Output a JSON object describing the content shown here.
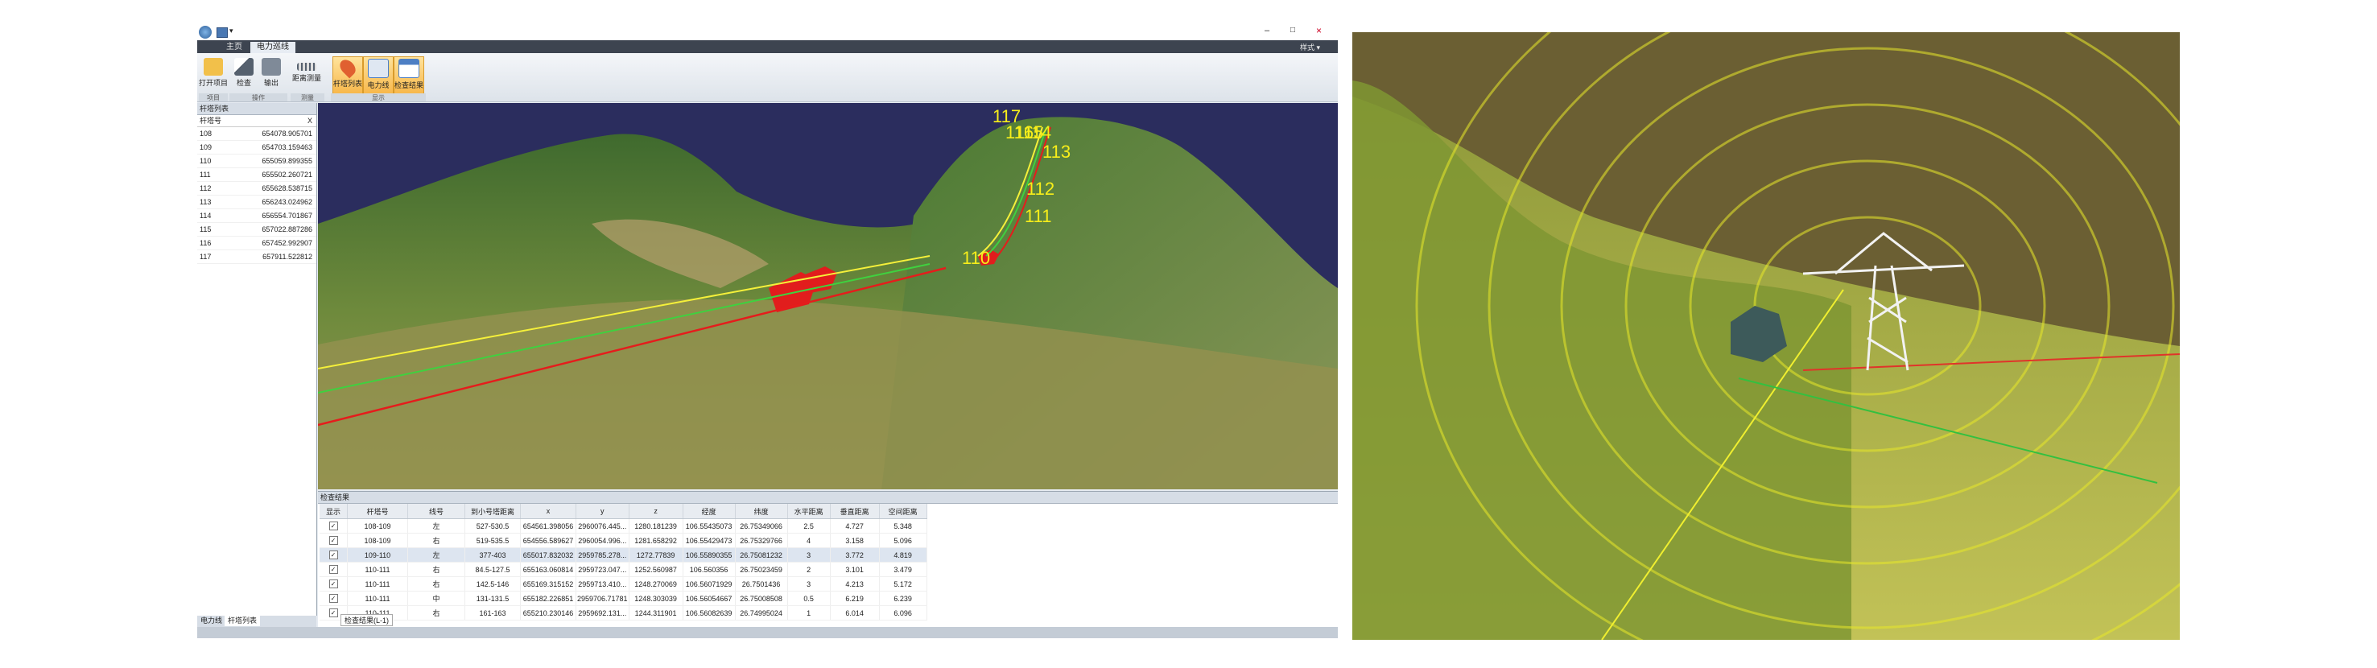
{
  "titlebar": {
    "window_controls": [
      "–",
      "□",
      "×"
    ],
    "quick_access": "▾",
    "style_menu": "样式 ▾"
  },
  "ribbon": {
    "tabs": [
      "主页",
      "电力巡线"
    ],
    "active_tab": 1,
    "buttons": [
      {
        "label": "打开项目",
        "icon": "folder-icon",
        "color": "#f2c04a"
      },
      {
        "label": "检查",
        "icon": "measure-icon",
        "color": "#55606e"
      },
      {
        "label": "输出",
        "icon": "export-icon",
        "color": "#55606e"
      },
      {
        "label": "距离测量",
        "icon": "ruler-icon",
        "color": "#55606e"
      },
      {
        "label": "杆塔列表",
        "icon": "location-pin-icon",
        "color": "#e06030"
      },
      {
        "label": "电力线",
        "icon": "powerline-icon",
        "color": "#4d7fc4"
      },
      {
        "label": "检查结果",
        "icon": "results-icon",
        "color": "#4d7fc4"
      }
    ],
    "groups": [
      "项目",
      "操作",
      "测量",
      "显示"
    ]
  },
  "tower_panel": {
    "title": "杆塔列表",
    "columns": [
      "杆塔号",
      "X"
    ],
    "rows": [
      [
        "108",
        "654078.905701"
      ],
      [
        "109",
        "654703.159463"
      ],
      [
        "110",
        "655059.899355"
      ],
      [
        "111",
        "655502.260721"
      ],
      [
        "112",
        "655628.538715"
      ],
      [
        "113",
        "656243.024962"
      ],
      [
        "114",
        "656554.701867"
      ],
      [
        "115",
        "657022.887286"
      ],
      [
        "116",
        "657452.992907"
      ],
      [
        "117",
        "657911.522812"
      ]
    ],
    "bottom_tabs": [
      "电力线",
      "杆塔列表"
    ]
  },
  "viewport": {
    "tower_labels": [
      "117",
      "116",
      "115",
      "114",
      "113",
      "112",
      "111",
      "110"
    ],
    "colors": {
      "sky": "#2b2d5e",
      "yellow_line": "#f5f03a",
      "green_line": "#3fd13f",
      "red_line": "#e51c1c",
      "label": "#f7ee1a"
    }
  },
  "results_panel": {
    "title": "检查结果",
    "columns": [
      "显示",
      "杆塔号",
      "线号",
      "到小号塔距离",
      "x",
      "y",
      "z",
      "经度",
      "纬度",
      "水平距离",
      "垂直距离",
      "空间距离"
    ],
    "rows": [
      [
        "✓",
        "108-109",
        "左",
        "527-530.5",
        "654561.398056",
        "2960076.445...",
        "1280.181239",
        "106.55435073",
        "26.75349066",
        "2.5",
        "4.727",
        "5.348"
      ],
      [
        "✓",
        "108-109",
        "右",
        "519-535.5",
        "654556.589627",
        "2960054.996...",
        "1281.658292",
        "106.55429473",
        "26.75329766",
        "4",
        "3.158",
        "5.096"
      ],
      [
        "✓",
        "109-110",
        "左",
        "377-403",
        "655017.832032",
        "2959785.278...",
        "1272.77839",
        "106.55890355",
        "26.75081232",
        "3",
        "3.772",
        "4.819"
      ],
      [
        "✓",
        "110-111",
        "右",
        "84.5-127.5",
        "655163.060814",
        "2959723.047...",
        "1252.560987",
        "106.560356",
        "26.75023459",
        "2",
        "3.101",
        "3.479"
      ],
      [
        "✓",
        "110-111",
        "右",
        "142.5-146",
        "655169.315152",
        "2959713.410...",
        "1248.270069",
        "106.56071929",
        "26.7501436",
        "3",
        "4.213",
        "5.172"
      ],
      [
        "✓",
        "110-111",
        "中",
        "131-131.5",
        "655182.226851",
        "2959706.71781",
        "1248.303039",
        "106.56054667",
        "26.75008508",
        "0.5",
        "6.219",
        "6.239"
      ],
      [
        "✓",
        "110-111",
        "右",
        "161-163",
        "655210.230146",
        "2959692.131...",
        "1244.311901",
        "106.56082639",
        "26.74995024",
        "1",
        "6.014",
        "6.096"
      ]
    ],
    "selected_row": 2,
    "bottom_tab": "检查结果(L-1)"
  },
  "right_view": {
    "colors": {
      "sky": "#6b5f33",
      "ground": "#aab33a",
      "corridor": "#e8e82a",
      "tower": "#f2f2f2",
      "red_line": "#e0342a",
      "green_line": "#33c040"
    }
  }
}
